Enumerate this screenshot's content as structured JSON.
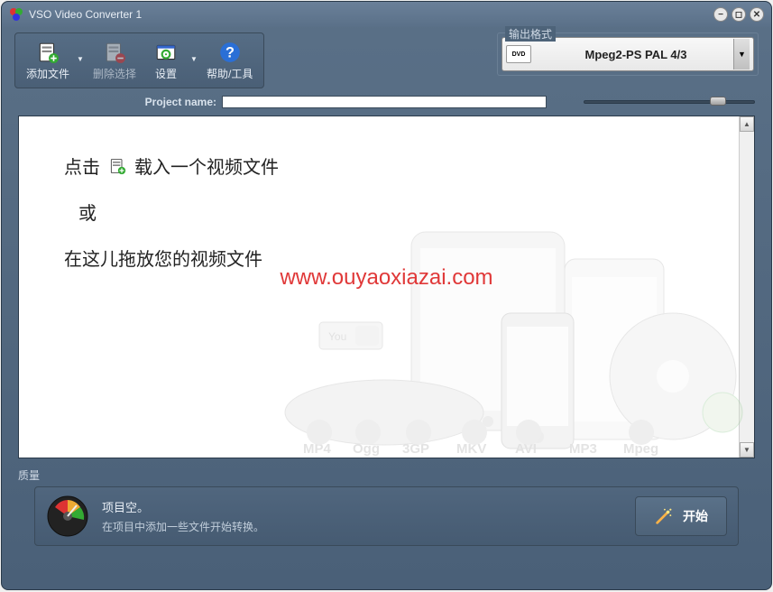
{
  "window": {
    "title": "VSO Video Converter 1"
  },
  "toolbar": {
    "add_file": "添加文件",
    "delete_selection": "删除选择",
    "settings": "设置",
    "help_tools": "帮助/工具"
  },
  "output_format": {
    "label": "输出格式",
    "icon_text": "DVD",
    "selected": "Mpeg2-PS PAL 4/3"
  },
  "project": {
    "label": "Project name:",
    "value": ""
  },
  "main": {
    "click_text_a": "点击",
    "click_text_b": "载入一个视频文件",
    "or_text": "或",
    "drag_text": "在这儿拖放您的视频文件"
  },
  "watermark": "www.ouyaoxiazai.com",
  "bg_labels": [
    "MP4",
    "Ogg",
    "3GP",
    "MKV",
    "AVI",
    "MP3",
    "Mpeg"
  ],
  "quality": {
    "label": "质量"
  },
  "status": {
    "line1": "项目空。",
    "line2": "在项目中添加一些文件开始转换。"
  },
  "start": {
    "label": "开始"
  }
}
